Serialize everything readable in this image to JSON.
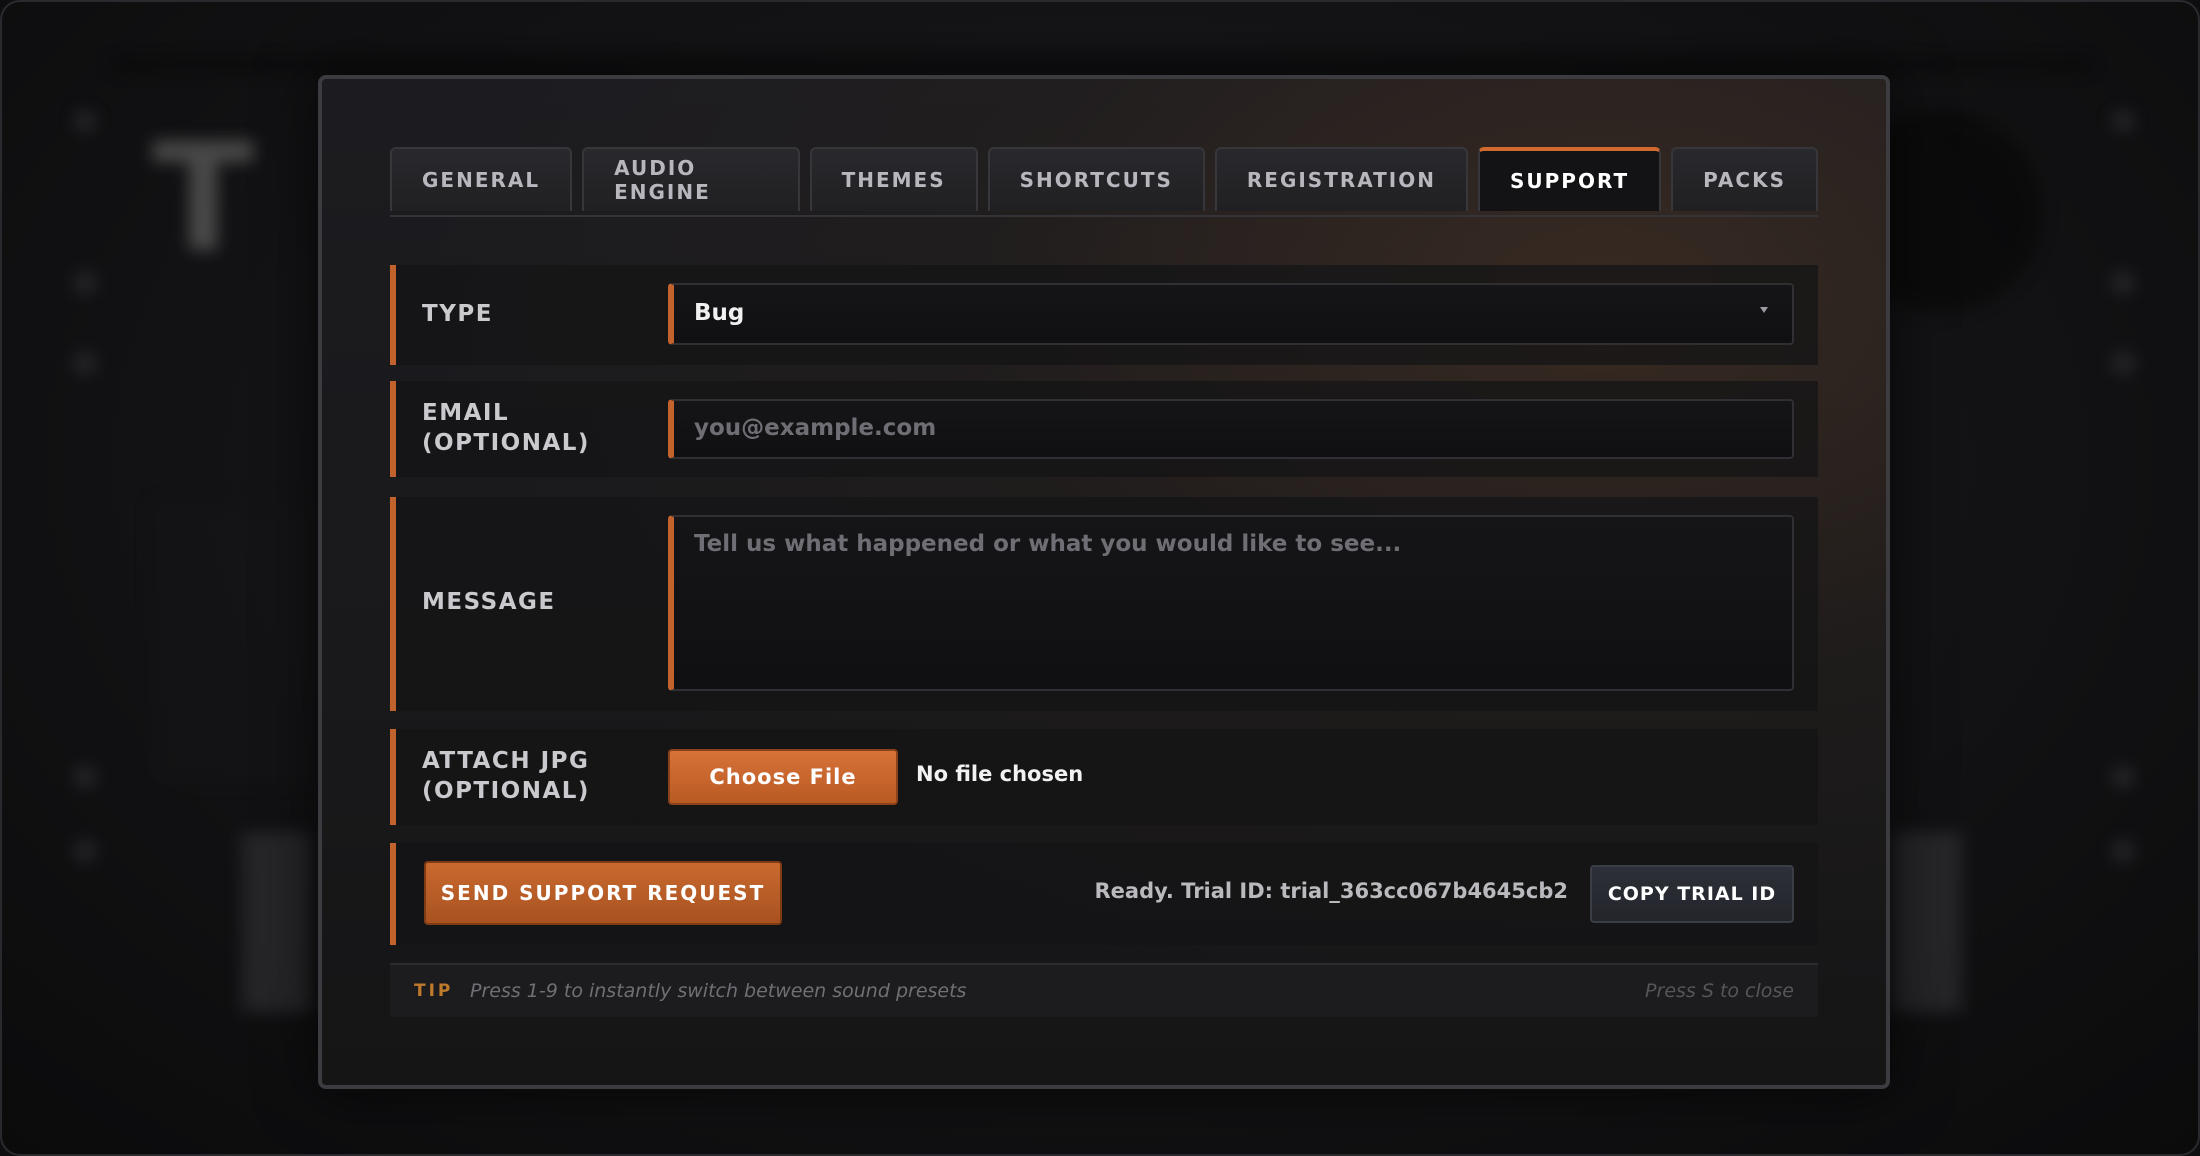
{
  "tabs": [
    {
      "label": "GENERAL"
    },
    {
      "label": "AUDIO ENGINE"
    },
    {
      "label": "THEMES"
    },
    {
      "label": "SHORTCUTS"
    },
    {
      "label": "REGISTRATION"
    },
    {
      "label": "SUPPORT",
      "active": true
    },
    {
      "label": "PACKS"
    }
  ],
  "form": {
    "type_label": "TYPE",
    "type_value": "Bug",
    "email_label_line1": "EMAIL",
    "email_label_line2": "(OPTIONAL)",
    "email_placeholder": "you@example.com",
    "message_label": "MESSAGE",
    "message_placeholder": "Tell us what happened or what you would like to see...",
    "attach_label_line1": "ATTACH JPG",
    "attach_label_line2": "(OPTIONAL)",
    "choose_file_label": "Choose File",
    "file_status": "No file chosen"
  },
  "actions": {
    "send_label": "SEND SUPPORT REQUEST",
    "status_text": "Ready. Trial ID: trial_363cc067b4645cb2",
    "copy_label": "COPY TRIAL ID"
  },
  "tip": {
    "label": "TIP",
    "text": "Press 1-9 to instantly switch between sound presets",
    "close_hint": "Press S to close"
  },
  "colors": {
    "accent": "#c2622c",
    "active_tab_border": "#d06a2e",
    "tip_label": "#c07a2c"
  }
}
